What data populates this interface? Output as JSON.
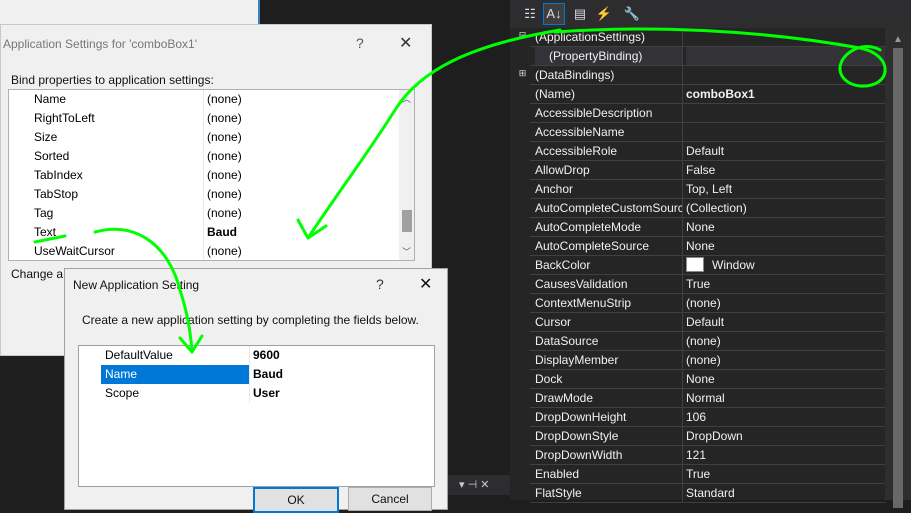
{
  "properties": {
    "toolbar": {
      "buttons": [
        {
          "icon": "categorized-icon",
          "glyph": "☷"
        },
        {
          "icon": "alphabetical-icon",
          "glyph": "A↓"
        },
        {
          "icon": "properties-icon",
          "glyph": "▤"
        },
        {
          "icon": "events-icon",
          "glyph": "⚡"
        },
        {
          "icon": "property-pages-icon",
          "glyph": "🔧"
        }
      ]
    },
    "rows": [
      {
        "name": "(ApplicationSettings)",
        "value": "",
        "expander": "⊟",
        "bold": false
      },
      {
        "name": "(PropertyBinding)",
        "value": "",
        "sub": true,
        "bold": false
      },
      {
        "name": "(DataBindings)",
        "value": "",
        "expander": "⊞",
        "bold": false
      },
      {
        "name": "(Name)",
        "value": "comboBox1",
        "bold": true
      },
      {
        "name": "AccessibleDescription",
        "value": "",
        "bold": false
      },
      {
        "name": "AccessibleName",
        "value": "",
        "bold": false
      },
      {
        "name": "AccessibleRole",
        "value": "Default",
        "bold": false
      },
      {
        "name": "AllowDrop",
        "value": "False",
        "bold": false
      },
      {
        "name": "Anchor",
        "value": "Top, Left",
        "bold": false
      },
      {
        "name": "AutoCompleteCustomSource",
        "value": "(Collection)",
        "bold": false
      },
      {
        "name": "AutoCompleteMode",
        "value": "None",
        "bold": false
      },
      {
        "name": "AutoCompleteSource",
        "value": "None",
        "bold": false
      },
      {
        "name": "BackColor",
        "value": "Window",
        "swatch": "#ffffff",
        "bold": false
      },
      {
        "name": "CausesValidation",
        "value": "True",
        "bold": false
      },
      {
        "name": "ContextMenuStrip",
        "value": "(none)",
        "bold": false
      },
      {
        "name": "Cursor",
        "value": "Default",
        "bold": false
      },
      {
        "name": "DataSource",
        "value": "(none)",
        "bold": false
      },
      {
        "name": "DisplayMember",
        "value": "(none)",
        "bold": false
      },
      {
        "name": "Dock",
        "value": "None",
        "bold": false
      },
      {
        "name": "DrawMode",
        "value": "Normal",
        "bold": false
      },
      {
        "name": "DropDownHeight",
        "value": "106",
        "bold": false
      },
      {
        "name": "DropDownStyle",
        "value": "DropDown",
        "bold": false
      },
      {
        "name": "DropDownWidth",
        "value": "121",
        "bold": false
      },
      {
        "name": "Enabled",
        "value": "True",
        "bold": false
      },
      {
        "name": "FlatStyle",
        "value": "Standard",
        "bold": false
      }
    ]
  },
  "app_settings_dialog": {
    "title": "Application Settings for 'comboBox1'",
    "help": "?",
    "close": "✕",
    "label": "Bind properties to application settings:",
    "rows": [
      {
        "name": "Name",
        "value": "(none)"
      },
      {
        "name": "RightToLeft",
        "value": "(none)"
      },
      {
        "name": "Size",
        "value": "(none)"
      },
      {
        "name": "Sorted",
        "value": "(none)"
      },
      {
        "name": "TabIndex",
        "value": "(none)"
      },
      {
        "name": "TabStop",
        "value": "(none)"
      },
      {
        "name": "Tag",
        "value": "(none)"
      },
      {
        "name": "Text",
        "value": "Baud",
        "bold": true
      },
      {
        "name": "UseWaitCursor",
        "value": "(none)"
      }
    ],
    "footer": "Change a"
  },
  "new_setting_dialog": {
    "title": "New Application Setting",
    "help": "?",
    "close": "✕",
    "description": "Create a new application setting by completing the fields below.",
    "rows": [
      {
        "name": "DefaultValue",
        "value": "9600"
      },
      {
        "name": "Name",
        "value": "Baud",
        "selected": true
      },
      {
        "name": "Scope",
        "value": "User"
      }
    ],
    "ok_label": "OK",
    "cancel_label": "Cancel"
  },
  "tabstrip": {
    "glyphs": "▾ ⊣ ✕"
  },
  "colors": {
    "accent": "#0078d7",
    "annotation": "#00ff00",
    "dark_bg": "#252526"
  }
}
